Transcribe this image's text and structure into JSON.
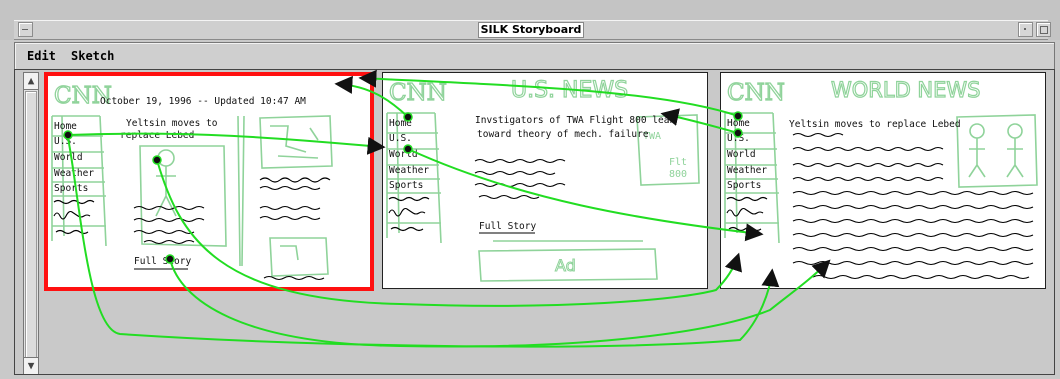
{
  "window": {
    "title": "SILK Storyboard"
  },
  "menu": {
    "items": [
      "Edit",
      "Sketch"
    ]
  },
  "frames": {
    "home": {
      "logo": "CNN",
      "date": "October 19, 1996 -- Updated 10:47 AM",
      "headline_1": "Yeltsin moves to",
      "headline_2": "replace Lebed",
      "nav": [
        "Home",
        "U.S.",
        "World",
        "Weather",
        "Sports"
      ],
      "full_story": "Full Story"
    },
    "us_news": {
      "logo": "CNN",
      "section": "U.S. NEWS",
      "headline_1": "Invstigators of TWA Flight 800 lean",
      "headline_2": "toward theory of mech. failure",
      "nav": [
        "Home",
        "U.S.",
        "World",
        "Weather",
        "Sports"
      ],
      "full_story": "Full Story",
      "ad": "Ad",
      "photo_label_1": "TWA",
      "photo_label_2": "Flt",
      "photo_label_3": "800"
    },
    "world_news": {
      "logo": "CNN",
      "section": "WORLD NEWS",
      "headline": "Yeltsin moves to replace Lebed",
      "nav": [
        "Home",
        "U.S.",
        "World",
        "Weather",
        "Sports"
      ]
    }
  },
  "colors": {
    "sketch": "#8fd39a",
    "link": "#22dd22",
    "selected": "#ff1010"
  }
}
